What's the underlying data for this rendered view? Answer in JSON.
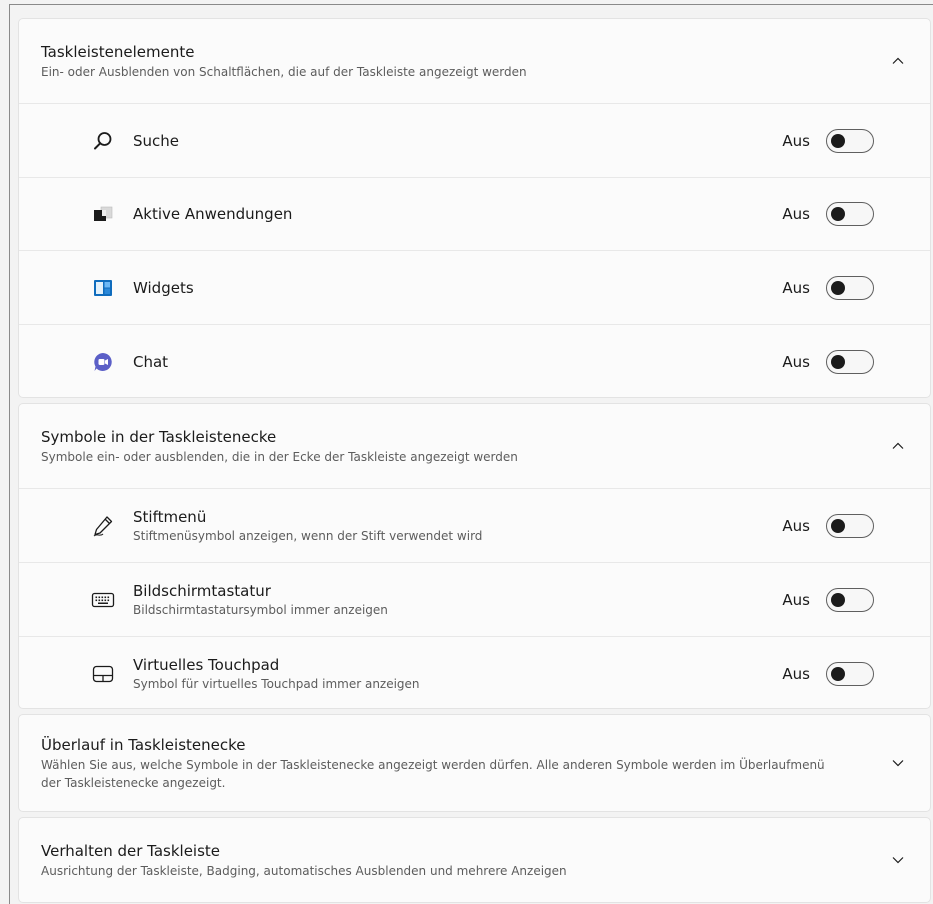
{
  "sections": [
    {
      "title": "Taskleistenelemente",
      "description": "Ein- oder Ausblenden von Schaltflächen, die auf der Taskleiste angezeigt werden",
      "expanded": true,
      "items": [
        {
          "label": "Suche",
          "icon": "search-icon",
          "state": "Aus"
        },
        {
          "label": "Aktive Anwendungen",
          "icon": "task-view-icon",
          "state": "Aus"
        },
        {
          "label": "Widgets",
          "icon": "widgets-icon",
          "state": "Aus"
        },
        {
          "label": "Chat",
          "icon": "chat-icon",
          "state": "Aus"
        }
      ]
    },
    {
      "title": "Symbole in der Taskleistenecke",
      "description": "Symbole ein- oder ausblenden, die in der Ecke der Taskleiste angezeigt werden",
      "expanded": true,
      "items": [
        {
          "label": "Stiftmenü",
          "sub": "Stiftmenüsymbol anzeigen, wenn der Stift verwendet wird",
          "icon": "pen-icon",
          "state": "Aus"
        },
        {
          "label": "Bildschirmtastatur",
          "sub": "Bildschirmtastatursymbol immer anzeigen",
          "icon": "keyboard-icon",
          "state": "Aus"
        },
        {
          "label": "Virtuelles Touchpad",
          "sub": "Symbol für virtuelles Touchpad immer anzeigen",
          "icon": "touchpad-icon",
          "state": "Aus"
        }
      ]
    },
    {
      "title": "Überlauf in Taskleistenecke",
      "description": "Wählen Sie aus, welche Symbole in der Taskleistenecke angezeigt werden dürfen. Alle anderen Symbole werden im Überlaufmenü der Taskleistenecke angezeigt.",
      "expanded": false
    },
    {
      "title": "Verhalten der Taskleiste",
      "description": "Ausrichtung der Taskleiste, Badging, automatisches Ausblenden und mehrere Anzeigen",
      "expanded": false
    }
  ],
  "colors": {
    "widgets_blue": "#0f6cbd",
    "chat_purple": "#5b5fc7"
  }
}
